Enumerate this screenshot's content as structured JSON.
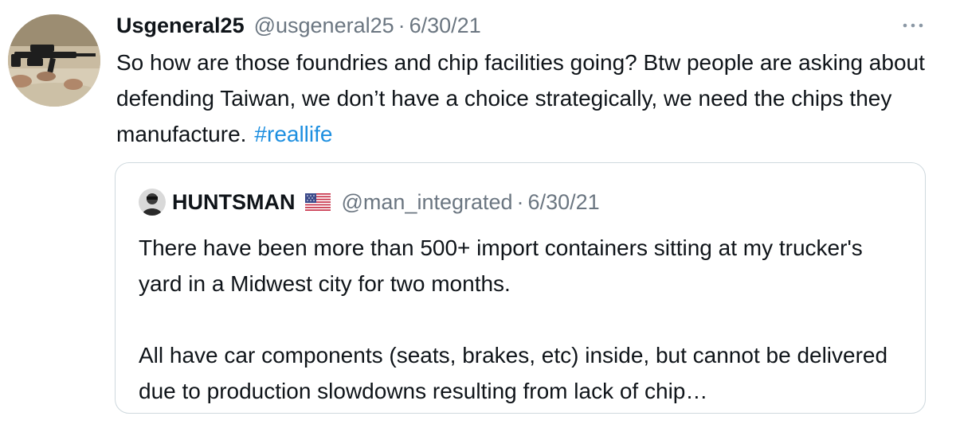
{
  "tweet": {
    "display_name": "Usgeneral25",
    "handle": "@usgeneral25",
    "separator": "·",
    "date": "6/30/21",
    "text": "So how are those foundries and chip facilities going? Btw people are asking about defending Taiwan, we don’t have a choice strategically, we need the chips they manufacture.",
    "hashtag": "#reallife",
    "more_icon": "ellipsis-icon",
    "avatar_icon": "rifle-photo-avatar"
  },
  "quoted_tweet": {
    "display_name": "HUNTSMAN",
    "flag_icon": "us-flag-icon",
    "handle": "@man_integrated",
    "separator": "·",
    "date": "6/30/21",
    "paragraph_1": "There have been more than 500+ import containers sitting at my trucker's yard in a Midwest city for two months.",
    "paragraph_2": "All have car components (seats, brakes, etc) inside, but cannot be delivered due to production slowdowns resulting from lack of chip…",
    "avatar_icon": "person-avatar"
  },
  "colors": {
    "text": "#0f1419",
    "secondary": "#6b7681",
    "link": "#1d8fe0",
    "border": "#cfd9de"
  }
}
